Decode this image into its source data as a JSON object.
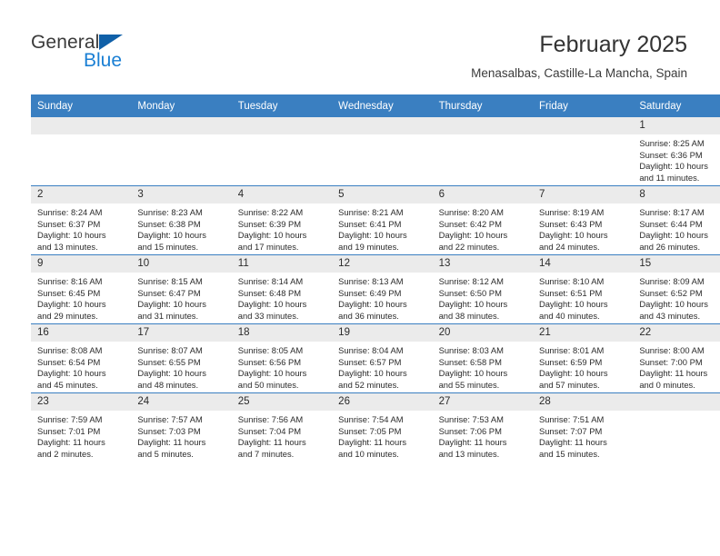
{
  "brand": {
    "name_part1": "General",
    "name_part2": "Blue",
    "flag_icon": "triangle-flag-icon"
  },
  "header": {
    "title": "February 2025",
    "subtitle": "Menasalbas, Castille-La Mancha, Spain"
  },
  "colors": {
    "header_blue": "#3a7fc1",
    "brand_blue": "#1a7fd4",
    "daynum_gray": "#ebebeb",
    "text": "#2b2b2b"
  },
  "calendar": {
    "weekday_headers": [
      "Sunday",
      "Monday",
      "Tuesday",
      "Wednesday",
      "Thursday",
      "Friday",
      "Saturday"
    ],
    "weeks": [
      [
        {
          "day": "",
          "sunrise": "",
          "sunset": "",
          "daylight_line1": "",
          "daylight_line2": "",
          "empty": true
        },
        {
          "day": "",
          "sunrise": "",
          "sunset": "",
          "daylight_line1": "",
          "daylight_line2": "",
          "empty": true
        },
        {
          "day": "",
          "sunrise": "",
          "sunset": "",
          "daylight_line1": "",
          "daylight_line2": "",
          "empty": true
        },
        {
          "day": "",
          "sunrise": "",
          "sunset": "",
          "daylight_line1": "",
          "daylight_line2": "",
          "empty": true
        },
        {
          "day": "",
          "sunrise": "",
          "sunset": "",
          "daylight_line1": "",
          "daylight_line2": "",
          "empty": true
        },
        {
          "day": "",
          "sunrise": "",
          "sunset": "",
          "daylight_line1": "",
          "daylight_line2": "",
          "empty": true
        },
        {
          "day": "1",
          "sunrise": "Sunrise: 8:25 AM",
          "sunset": "Sunset: 6:36 PM",
          "daylight_line1": "Daylight: 10 hours",
          "daylight_line2": "and 11 minutes.",
          "empty": false
        }
      ],
      [
        {
          "day": "2",
          "sunrise": "Sunrise: 8:24 AM",
          "sunset": "Sunset: 6:37 PM",
          "daylight_line1": "Daylight: 10 hours",
          "daylight_line2": "and 13 minutes.",
          "empty": false
        },
        {
          "day": "3",
          "sunrise": "Sunrise: 8:23 AM",
          "sunset": "Sunset: 6:38 PM",
          "daylight_line1": "Daylight: 10 hours",
          "daylight_line2": "and 15 minutes.",
          "empty": false
        },
        {
          "day": "4",
          "sunrise": "Sunrise: 8:22 AM",
          "sunset": "Sunset: 6:39 PM",
          "daylight_line1": "Daylight: 10 hours",
          "daylight_line2": "and 17 minutes.",
          "empty": false
        },
        {
          "day": "5",
          "sunrise": "Sunrise: 8:21 AM",
          "sunset": "Sunset: 6:41 PM",
          "daylight_line1": "Daylight: 10 hours",
          "daylight_line2": "and 19 minutes.",
          "empty": false
        },
        {
          "day": "6",
          "sunrise": "Sunrise: 8:20 AM",
          "sunset": "Sunset: 6:42 PM",
          "daylight_line1": "Daylight: 10 hours",
          "daylight_line2": "and 22 minutes.",
          "empty": false
        },
        {
          "day": "7",
          "sunrise": "Sunrise: 8:19 AM",
          "sunset": "Sunset: 6:43 PM",
          "daylight_line1": "Daylight: 10 hours",
          "daylight_line2": "and 24 minutes.",
          "empty": false
        },
        {
          "day": "8",
          "sunrise": "Sunrise: 8:17 AM",
          "sunset": "Sunset: 6:44 PM",
          "daylight_line1": "Daylight: 10 hours",
          "daylight_line2": "and 26 minutes.",
          "empty": false
        }
      ],
      [
        {
          "day": "9",
          "sunrise": "Sunrise: 8:16 AM",
          "sunset": "Sunset: 6:45 PM",
          "daylight_line1": "Daylight: 10 hours",
          "daylight_line2": "and 29 minutes.",
          "empty": false
        },
        {
          "day": "10",
          "sunrise": "Sunrise: 8:15 AM",
          "sunset": "Sunset: 6:47 PM",
          "daylight_line1": "Daylight: 10 hours",
          "daylight_line2": "and 31 minutes.",
          "empty": false
        },
        {
          "day": "11",
          "sunrise": "Sunrise: 8:14 AM",
          "sunset": "Sunset: 6:48 PM",
          "daylight_line1": "Daylight: 10 hours",
          "daylight_line2": "and 33 minutes.",
          "empty": false
        },
        {
          "day": "12",
          "sunrise": "Sunrise: 8:13 AM",
          "sunset": "Sunset: 6:49 PM",
          "daylight_line1": "Daylight: 10 hours",
          "daylight_line2": "and 36 minutes.",
          "empty": false
        },
        {
          "day": "13",
          "sunrise": "Sunrise: 8:12 AM",
          "sunset": "Sunset: 6:50 PM",
          "daylight_line1": "Daylight: 10 hours",
          "daylight_line2": "and 38 minutes.",
          "empty": false
        },
        {
          "day": "14",
          "sunrise": "Sunrise: 8:10 AM",
          "sunset": "Sunset: 6:51 PM",
          "daylight_line1": "Daylight: 10 hours",
          "daylight_line2": "and 40 minutes.",
          "empty": false
        },
        {
          "day": "15",
          "sunrise": "Sunrise: 8:09 AM",
          "sunset": "Sunset: 6:52 PM",
          "daylight_line1": "Daylight: 10 hours",
          "daylight_line2": "and 43 minutes.",
          "empty": false
        }
      ],
      [
        {
          "day": "16",
          "sunrise": "Sunrise: 8:08 AM",
          "sunset": "Sunset: 6:54 PM",
          "daylight_line1": "Daylight: 10 hours",
          "daylight_line2": "and 45 minutes.",
          "empty": false
        },
        {
          "day": "17",
          "sunrise": "Sunrise: 8:07 AM",
          "sunset": "Sunset: 6:55 PM",
          "daylight_line1": "Daylight: 10 hours",
          "daylight_line2": "and 48 minutes.",
          "empty": false
        },
        {
          "day": "18",
          "sunrise": "Sunrise: 8:05 AM",
          "sunset": "Sunset: 6:56 PM",
          "daylight_line1": "Daylight: 10 hours",
          "daylight_line2": "and 50 minutes.",
          "empty": false
        },
        {
          "day": "19",
          "sunrise": "Sunrise: 8:04 AM",
          "sunset": "Sunset: 6:57 PM",
          "daylight_line1": "Daylight: 10 hours",
          "daylight_line2": "and 52 minutes.",
          "empty": false
        },
        {
          "day": "20",
          "sunrise": "Sunrise: 8:03 AM",
          "sunset": "Sunset: 6:58 PM",
          "daylight_line1": "Daylight: 10 hours",
          "daylight_line2": "and 55 minutes.",
          "empty": false
        },
        {
          "day": "21",
          "sunrise": "Sunrise: 8:01 AM",
          "sunset": "Sunset: 6:59 PM",
          "daylight_line1": "Daylight: 10 hours",
          "daylight_line2": "and 57 minutes.",
          "empty": false
        },
        {
          "day": "22",
          "sunrise": "Sunrise: 8:00 AM",
          "sunset": "Sunset: 7:00 PM",
          "daylight_line1": "Daylight: 11 hours",
          "daylight_line2": "and 0 minutes.",
          "empty": false
        }
      ],
      [
        {
          "day": "23",
          "sunrise": "Sunrise: 7:59 AM",
          "sunset": "Sunset: 7:01 PM",
          "daylight_line1": "Daylight: 11 hours",
          "daylight_line2": "and 2 minutes.",
          "empty": false
        },
        {
          "day": "24",
          "sunrise": "Sunrise: 7:57 AM",
          "sunset": "Sunset: 7:03 PM",
          "daylight_line1": "Daylight: 11 hours",
          "daylight_line2": "and 5 minutes.",
          "empty": false
        },
        {
          "day": "25",
          "sunrise": "Sunrise: 7:56 AM",
          "sunset": "Sunset: 7:04 PM",
          "daylight_line1": "Daylight: 11 hours",
          "daylight_line2": "and 7 minutes.",
          "empty": false
        },
        {
          "day": "26",
          "sunrise": "Sunrise: 7:54 AM",
          "sunset": "Sunset: 7:05 PM",
          "daylight_line1": "Daylight: 11 hours",
          "daylight_line2": "and 10 minutes.",
          "empty": false
        },
        {
          "day": "27",
          "sunrise": "Sunrise: 7:53 AM",
          "sunset": "Sunset: 7:06 PM",
          "daylight_line1": "Daylight: 11 hours",
          "daylight_line2": "and 13 minutes.",
          "empty": false
        },
        {
          "day": "28",
          "sunrise": "Sunrise: 7:51 AM",
          "sunset": "Sunset: 7:07 PM",
          "daylight_line1": "Daylight: 11 hours",
          "daylight_line2": "and 15 minutes.",
          "empty": false
        },
        {
          "day": "",
          "sunrise": "",
          "sunset": "",
          "daylight_line1": "",
          "daylight_line2": "",
          "empty": true
        }
      ]
    ]
  }
}
